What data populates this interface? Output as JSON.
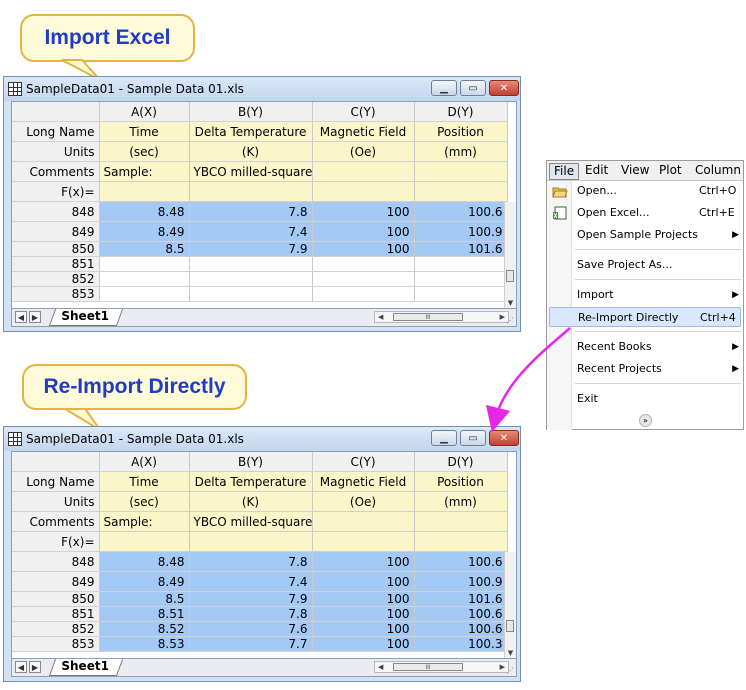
{
  "callouts": {
    "top": "Import Excel",
    "bottom": "Re-Import Directly"
  },
  "window_title": "SampleData01 - Sample Data 01.xls",
  "columns": [
    "A(X)",
    "B(Y)",
    "C(Y)",
    "D(Y)"
  ],
  "meta_rows": {
    "long_name": {
      "label": "Long Name",
      "values": [
        "Time",
        "Delta Temperature",
        "Magnetic Field",
        "Position"
      ]
    },
    "units": {
      "label": "Units",
      "values": [
        "(sec)",
        "(K)",
        "(Oe)",
        "(mm)"
      ]
    },
    "comments": {
      "label": "Comments",
      "values": [
        "Sample:",
        "YBCO milled-square",
        "",
        ""
      ]
    },
    "fx": {
      "label": "F(x)="
    }
  },
  "top_grid": {
    "data_rows": [
      {
        "row": "848",
        "values": [
          "8.48",
          "7.8",
          "100",
          "100.6"
        ]
      },
      {
        "row": "849",
        "values": [
          "8.49",
          "7.4",
          "100",
          "100.9"
        ]
      },
      {
        "row": "850",
        "values": [
          "8.5",
          "7.9",
          "100",
          "101.6"
        ]
      }
    ],
    "empty_rows": [
      "851",
      "852",
      "853"
    ]
  },
  "bottom_grid": {
    "data_rows": [
      {
        "row": "848",
        "values": [
          "8.48",
          "7.8",
          "100",
          "100.6"
        ]
      },
      {
        "row": "849",
        "values": [
          "8.49",
          "7.4",
          "100",
          "100.9"
        ]
      },
      {
        "row": "850",
        "values": [
          "8.5",
          "7.9",
          "100",
          "101.6"
        ]
      },
      {
        "row": "851",
        "values": [
          "8.51",
          "7.8",
          "100",
          "100.6"
        ]
      },
      {
        "row": "852",
        "values": [
          "8.52",
          "7.6",
          "100",
          "100.6"
        ]
      },
      {
        "row": "853",
        "values": [
          "8.53",
          "7.7",
          "100",
          "100.3"
        ]
      }
    ]
  },
  "sheet_tab": "Sheet1",
  "menu": {
    "bar": [
      "File",
      "Edit",
      "View",
      "Plot",
      "Column"
    ],
    "items": {
      "open": {
        "label": "Open...",
        "shortcut": "Ctrl+O"
      },
      "open_excel": {
        "label": "Open Excel...",
        "shortcut": "Ctrl+E"
      },
      "open_sample": {
        "label": "Open Sample Projects"
      },
      "save_as": {
        "label": "Save Project As..."
      },
      "import": {
        "label": "Import"
      },
      "reimport": {
        "label": "Re-Import Directly",
        "shortcut": "Ctrl+4"
      },
      "recent_books": {
        "label": "Recent Books"
      },
      "recent_projects": {
        "label": "Recent Projects"
      },
      "exit": {
        "label": "Exit"
      }
    }
  },
  "colors": {
    "selection": "#a3c9f4",
    "meta_bg": "#fbf6c9",
    "callout_text": "#1f3cc9",
    "arrow": "#e627e6"
  }
}
